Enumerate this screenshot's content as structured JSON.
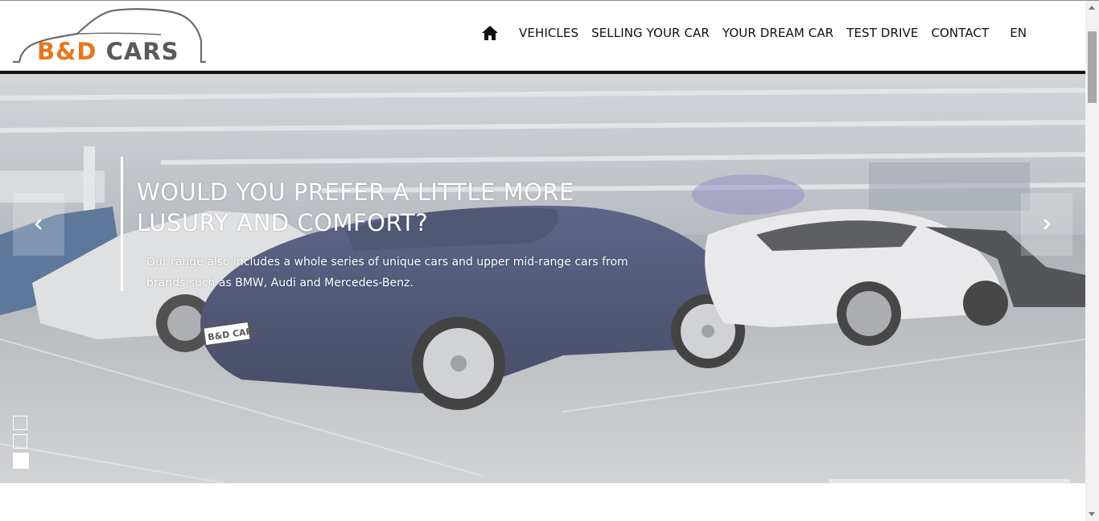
{
  "brand": {
    "logo_part1": "B&D",
    "logo_part2": "CARS",
    "primary_color": "#e8761f",
    "secondary_color": "#5a5a5a"
  },
  "nav": {
    "home_icon": "home-icon",
    "items": [
      {
        "label": "VEHICLES"
      },
      {
        "label": "SELLING YOUR CAR"
      },
      {
        "label": "YOUR DREAM CAR"
      },
      {
        "label": "TEST DRIVE"
      },
      {
        "label": "CONTACT"
      }
    ],
    "language": "EN"
  },
  "hero": {
    "title": "WOULD YOU PREFER A LITTLE MORE LUSURY AND COMFORT?",
    "text": "Our range also includes a whole series of unique cars and upper mid-range cars from brands such as BMW, Audi and Mercedes-Benz.",
    "plate_text": "B&D CARS",
    "prev_icon": "chevron-left-icon",
    "next_icon": "chevron-right-icon",
    "slides_count": 3,
    "active_slide": 3
  }
}
